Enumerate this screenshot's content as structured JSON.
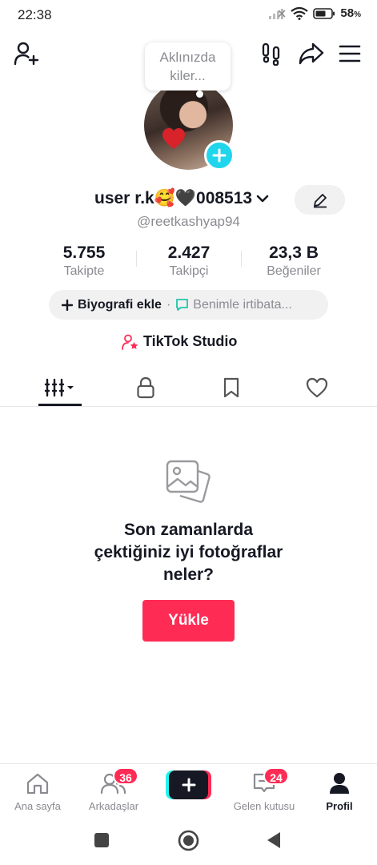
{
  "status_bar": {
    "time": "22:38",
    "battery": "58",
    "battery_unit": "%"
  },
  "note_bubble": {
    "line1": "Aklınızda",
    "line2": "kiler..."
  },
  "profile": {
    "display_name": "user r.k🥰🖤008513",
    "handle": "@reetkashyap94"
  },
  "stats": [
    {
      "value": "5.755",
      "label": "Takipte"
    },
    {
      "value": "2.427",
      "label": "Takipçi"
    },
    {
      "value": "23,3 B",
      "label": "Beğeniler"
    }
  ],
  "bio": {
    "add_label": "Biyografi ekle",
    "separator": "·",
    "contact_label": "Benimle irtibata..."
  },
  "studio": {
    "label": "TikTok Studio"
  },
  "empty_state": {
    "line1": "Son zamanlarda",
    "line2": "çektiğiniz iyi fotoğraflar",
    "line3": "neler?",
    "button": "Yükle"
  },
  "bottom_nav": {
    "home": "Ana sayfa",
    "friends": "Arkadaşlar",
    "friends_badge": "36",
    "inbox": "Gelen kutusu",
    "inbox_badge": "24",
    "profile": "Profil"
  },
  "colors": {
    "accent": "#fe2c55",
    "cyan": "#20d5ec",
    "text": "#161823",
    "muted": "#8a8b91"
  }
}
